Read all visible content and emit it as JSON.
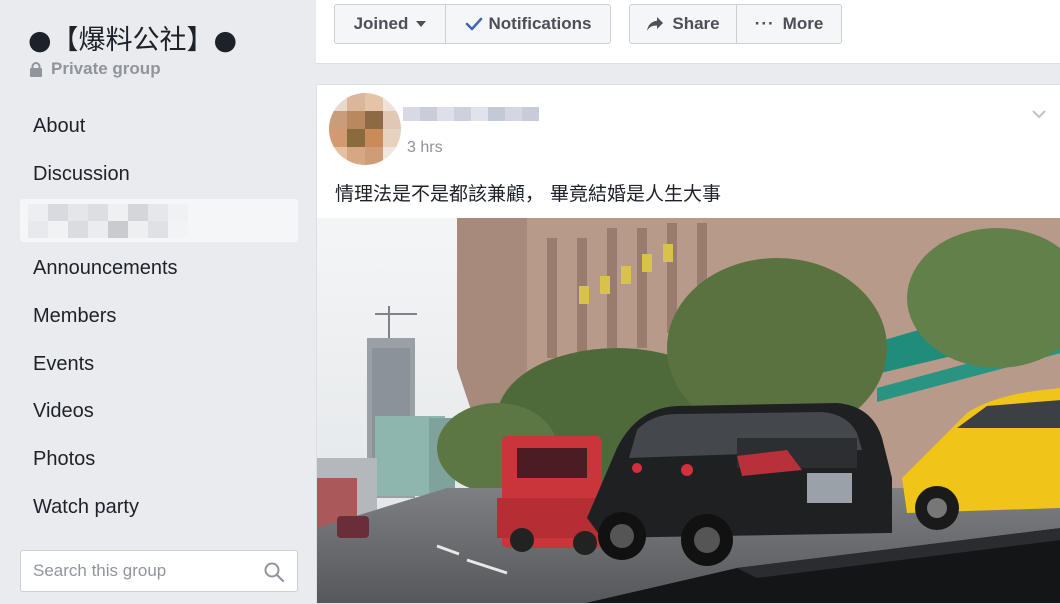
{
  "group": {
    "title": "●【爆料公社】●",
    "privacy": "Private group"
  },
  "sidebar": {
    "items": [
      {
        "label": "About"
      },
      {
        "label": "Discussion"
      },
      {
        "label": ""
      },
      {
        "label": "Announcements"
      },
      {
        "label": "Members"
      },
      {
        "label": "Events"
      },
      {
        "label": "Videos"
      },
      {
        "label": "Photos"
      },
      {
        "label": "Watch party"
      }
    ],
    "search_placeholder": "Search this group"
  },
  "toolbar": {
    "joined_label": "Joined",
    "notifications_label": "Notifications",
    "share_label": "Share",
    "more_label": "More"
  },
  "post": {
    "time": "3 hrs",
    "text": "情理法是不是都該兼顧， 畢竟結婚是人生大事"
  },
  "icons": [
    "lock-icon",
    "search-icon",
    "caret-down-icon",
    "check-icon",
    "share-arrow-icon",
    "more-dots-icon",
    "chevron-down-icon"
  ],
  "colors": {
    "accent": "#4267b2",
    "background": "#e9ebee",
    "text": "#1d2129",
    "muted": "#90949c"
  }
}
